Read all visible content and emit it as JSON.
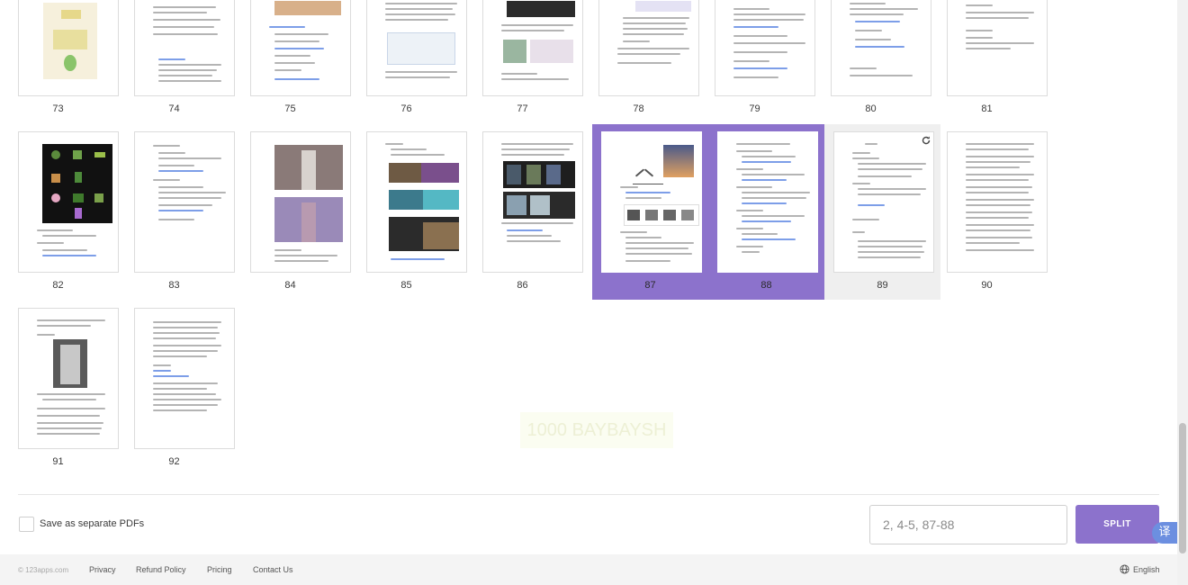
{
  "top_pages": [
    {
      "n": "73"
    },
    {
      "n": "74"
    },
    {
      "n": "75"
    },
    {
      "n": "76"
    },
    {
      "n": "77"
    },
    {
      "n": "78"
    },
    {
      "n": "79"
    },
    {
      "n": "80"
    },
    {
      "n": "81"
    }
  ],
  "row2_pages": [
    {
      "n": "82"
    },
    {
      "n": "83"
    },
    {
      "n": "84"
    },
    {
      "n": "85"
    },
    {
      "n": "86"
    },
    {
      "n": "87"
    },
    {
      "n": "88"
    },
    {
      "n": "89"
    },
    {
      "n": "90"
    }
  ],
  "row3_pages": [
    {
      "n": "91"
    },
    {
      "n": "92"
    }
  ],
  "selected_pages": [
    "87",
    "88"
  ],
  "hovered_page": "89",
  "split_options": {
    "separate_label": "Save as separate PDFs",
    "range_placeholder": "2, 4-5, 87-88",
    "split_label": "SPLIT"
  },
  "translate_glyph": "译",
  "watermark_text": "1000 BAYBAYSH",
  "footer": {
    "copyright": "© 123apps.com",
    "links": [
      "Privacy",
      "Refund Policy",
      "Pricing",
      "Contact Us"
    ],
    "language": "English"
  },
  "colors": {
    "accent": "#8c72cc",
    "link": "#7d9ee8"
  }
}
